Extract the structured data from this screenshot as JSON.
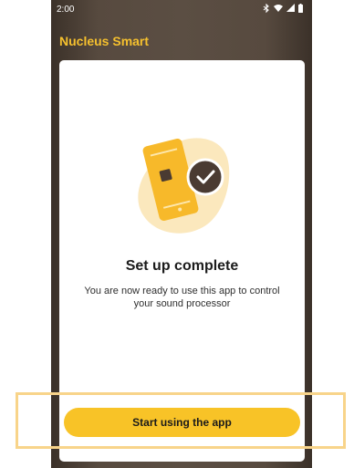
{
  "status_bar": {
    "time": "2:00",
    "icons": [
      "bluetooth-icon",
      "wifi-icon",
      "signal-icon",
      "battery-icon"
    ]
  },
  "app": {
    "title": "Nucleus Smart"
  },
  "setup": {
    "illustration": "phone-checkmark-illustration",
    "heading": "Set up complete",
    "message": "You are now ready to use this app to control your sound processor"
  },
  "actions": {
    "start_label": "Start using the app"
  },
  "colors": {
    "accent": "#f8c327",
    "title": "#f5c02e",
    "background_dark": "#5b4e43",
    "highlight": "#f8d48a"
  }
}
